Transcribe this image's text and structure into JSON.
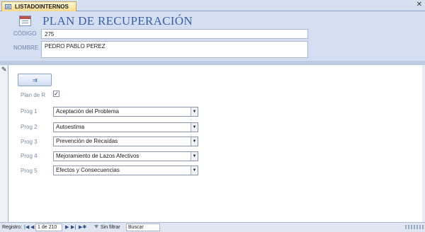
{
  "tab": {
    "label": "LISTADOINTERNOS"
  },
  "header": {
    "title": "PLAN DE RECUPERACIÓN",
    "codigo_label": "CÓDIGO",
    "codigo_value": "275",
    "nombre_label": "NOMBRE",
    "nombre_value": "PEDRO PABLO PEREZ"
  },
  "detail": {
    "plan_label": "Plan de R",
    "plan_checked": true,
    "progs": [
      {
        "label": "Prog 1",
        "value": "Aceptación del Problema"
      },
      {
        "label": "Prog 2",
        "value": "Autoestima"
      },
      {
        "label": "Prog 3",
        "value": "Prevención de Recaídas"
      },
      {
        "label": "Prog 4",
        "value": "Mejoramiento de Lazos Afectivos"
      },
      {
        "label": "Prog 5",
        "value": "Efectos y Consecuencias"
      }
    ]
  },
  "navbar": {
    "registro_label": "Registro:",
    "record_position": "1 de 210",
    "filter_label": "Sin filtrar",
    "search_label": "Buscar"
  },
  "icons": {
    "tab": "form-icon",
    "close": "close-icon",
    "pencil": "pencil-icon",
    "button": "macro-icon"
  }
}
